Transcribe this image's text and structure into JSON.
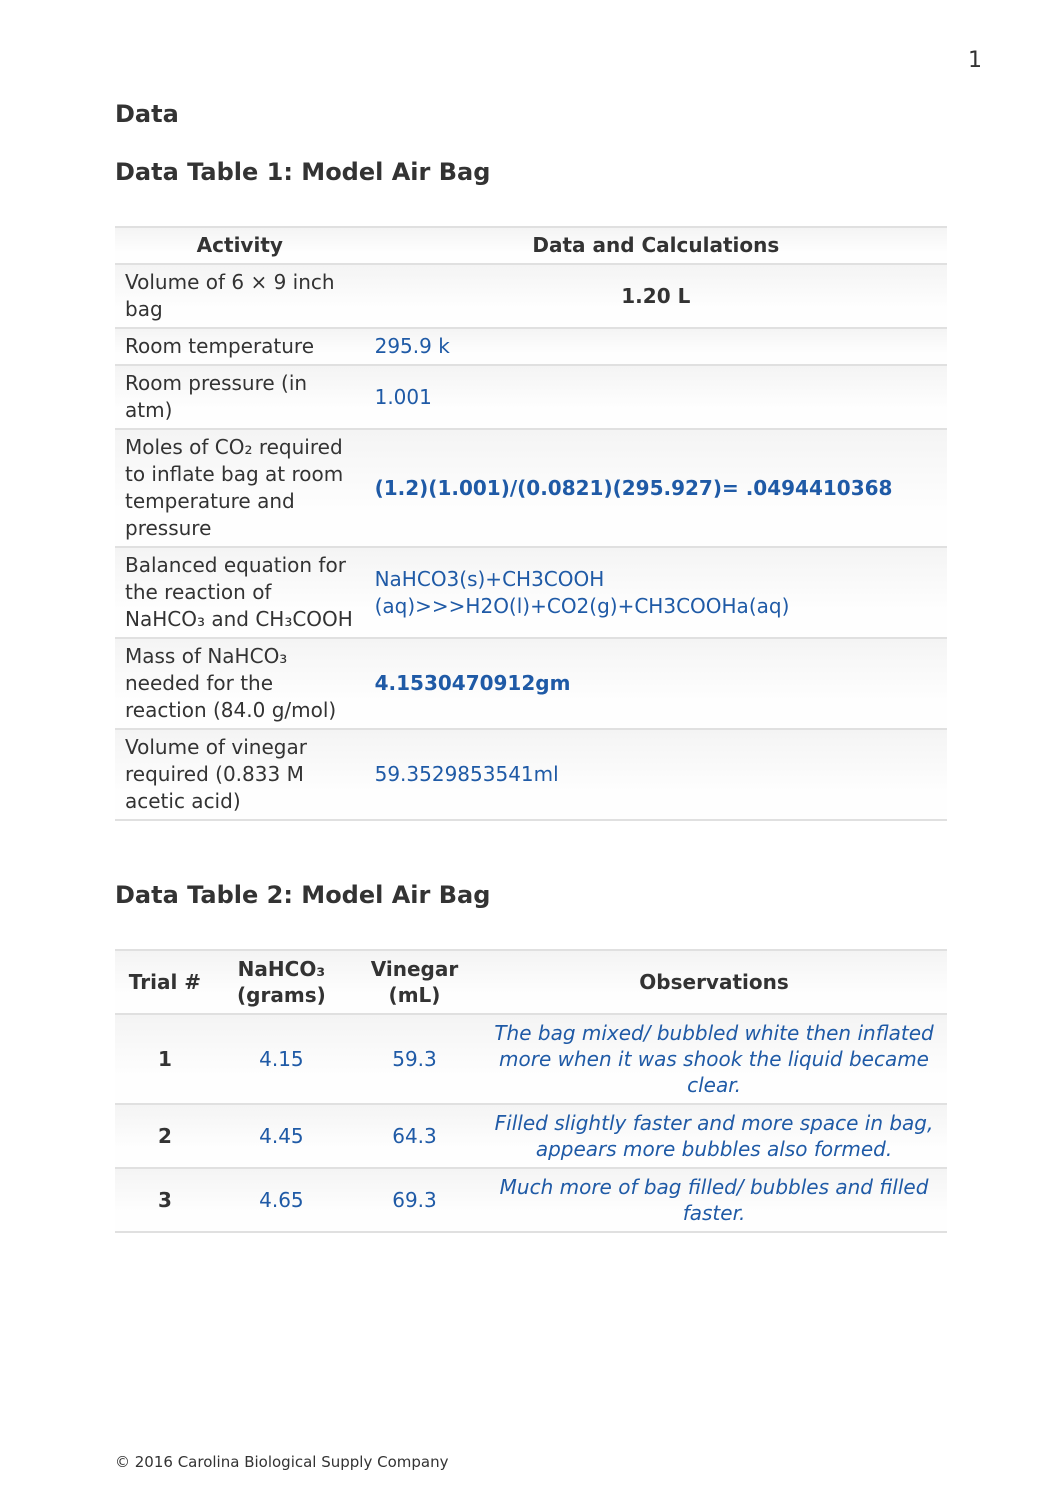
{
  "page_number": "1",
  "section_heading": "Data",
  "table1": {
    "title": "Data Table 1: Model Air Bag",
    "header_activity": "Activity",
    "header_data": "Data and Calculations",
    "rows": [
      {
        "activity": "Volume of 6 × 9 inch bag",
        "value": "1.20 L",
        "value_class": "bold center"
      },
      {
        "activity": "Room temperature",
        "value": "295.9 k",
        "value_class": "blue"
      },
      {
        "activity": "Room pressure (in atm)",
        "value": "1.001",
        "value_class": "blue"
      },
      {
        "activity": "Moles of CO₂ required to inflate bag at room temperature and pressure",
        "value": "(1.2)(1.001)/(0.0821)(295.927)= .0494410368",
        "value_class": "blue-bold"
      },
      {
        "activity": "Balanced equation for the reaction of NaHCO₃ and CH₃COOH",
        "value": "NaHCO3(s)+CH3COOH (aq)>>>H2O(l)+CO2(g)+CH3COOHa(aq)",
        "value_class": "blue"
      },
      {
        "activity": "Mass of NaHCO₃ needed for the reaction (84.0 g/mol)",
        "value": "4.1530470912gm",
        "value_class": "blue-bold"
      },
      {
        "activity": "Volume of vinegar required  (0.833 M acetic acid)",
        "value": "59.3529853541ml",
        "value_class": "blue"
      }
    ]
  },
  "table2": {
    "title": "Data Table 2: Model Air Bag",
    "headers": {
      "trial": "Trial #",
      "nahco3_line1": "NaHCO₃",
      "nahco3_line2": "(grams)",
      "vinegar_line1": "Vinegar",
      "vinegar_line2": "(mL)",
      "observations": "Observations"
    },
    "rows": [
      {
        "trial": "1",
        "nahco3": "4.15",
        "vinegar": "59.3",
        "obs": "The bag mixed/ bubbled white then inflated more when it was shook the liquid became clear."
      },
      {
        "trial": "2",
        "nahco3": "4.45",
        "vinegar": "64.3",
        "obs": "Filled slightly faster and more space in bag, appears more bubbles also formed."
      },
      {
        "trial": "3",
        "nahco3": "4.65",
        "vinegar": "69.3",
        "obs": "Much more of bag filled/ bubbles and filled faster."
      }
    ]
  },
  "footer": "© 2016 Carolina Biological Supply Company"
}
